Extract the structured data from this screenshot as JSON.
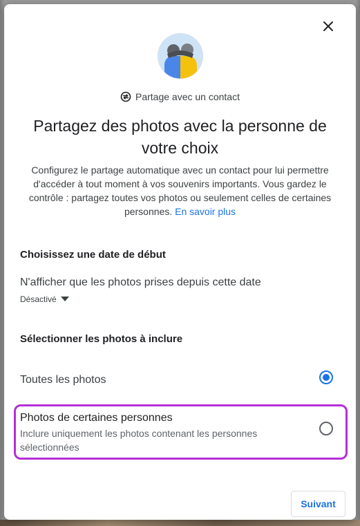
{
  "dialog": {
    "contact_label": "Partage avec un contact",
    "title": "Partagez des photos avec la personne de votre choix",
    "description": "Configurez le partage automatique avec un contact pour lui permettre d'accéder à tout moment à vos souvenirs importants. Vous gardez le contrôle : partagez toutes vos photos ou seulement celles de certaines personnes.",
    "learn_more": "En savoir plus",
    "start_date": {
      "heading": "Choisissez une date de début",
      "label": "N'afficher que les photos prises depuis cette date",
      "value": "Désactivé"
    },
    "photos": {
      "heading": "Sélectionner les photos à inclure",
      "option_all": "Toutes les photos",
      "option_all_selected": true,
      "option_some_title": "Photos de certaines personnes",
      "option_some_desc": "Inclure uniquement les photos contenant les personnes sélectionnées",
      "option_some_selected": false
    },
    "next_label": "Suivant"
  },
  "icons": {
    "close": "close-icon",
    "share_contact": "partner-sharing-icon",
    "dropdown": "arrow-drop-down-icon"
  },
  "colors": {
    "accent": "#1a73e8",
    "highlight": "#b42fd6"
  }
}
